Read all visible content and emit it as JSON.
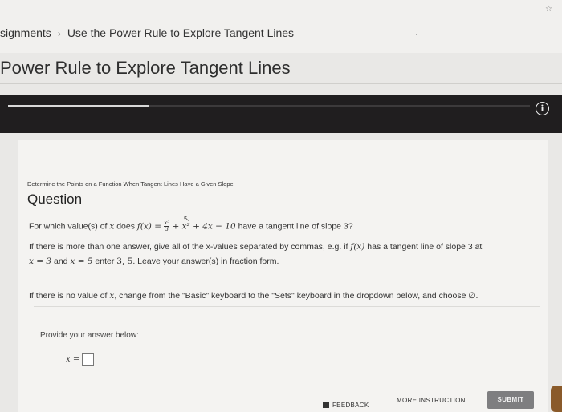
{
  "header": {
    "breadcrumb": [
      "signments",
      "Use the Power Rule to Explore Tangent Lines"
    ],
    "breadcrumb_separator": "›",
    "star_icon": "☆"
  },
  "page": {
    "title": "Power Rule to Explore Tangent Lines"
  },
  "video": {
    "progress": 0.27,
    "info_glyph": "i"
  },
  "question": {
    "subheading": "Determine the Points on a Function When Tangent Lines Have a Given Slope",
    "heading": "Question",
    "prompt_prefix": "For which value(s) of ",
    "prompt_var": "x",
    "prompt_mid": " does ",
    "prompt_fx": "f(x) = ",
    "frac_num": "x³",
    "frac_den": "3",
    "prompt_poly": " + x² + 4x − 10",
    "prompt_suffix": " have a tangent line of slope 3?",
    "instr1_a": "If there is more than one answer, give all of the x-values separated by commas, e.g. if ",
    "instr1_fx": "f(x)",
    "instr1_b": " has a tangent line of slope 3 at",
    "instr2_a": "x = 3",
    "instr2_b": " and ",
    "instr2_c": "x = 5",
    "instr2_d": " enter ",
    "instr2_e": "3, 5",
    "instr2_f": ". Leave your answer(s) in fraction form.",
    "instr3_a": "If there is no value of ",
    "instr3_var": "x",
    "instr3_b": ", change from the \"Basic\" keyboard to the \"Sets\" keyboard in the dropdown below, and choose ∅.",
    "provide_label": "Provide your answer below:",
    "answer_label": "x ="
  },
  "actions": {
    "feedback": "FEEDBACK",
    "more_instruction": "MORE INSTRUCTION",
    "submit": "SUBMIT"
  }
}
